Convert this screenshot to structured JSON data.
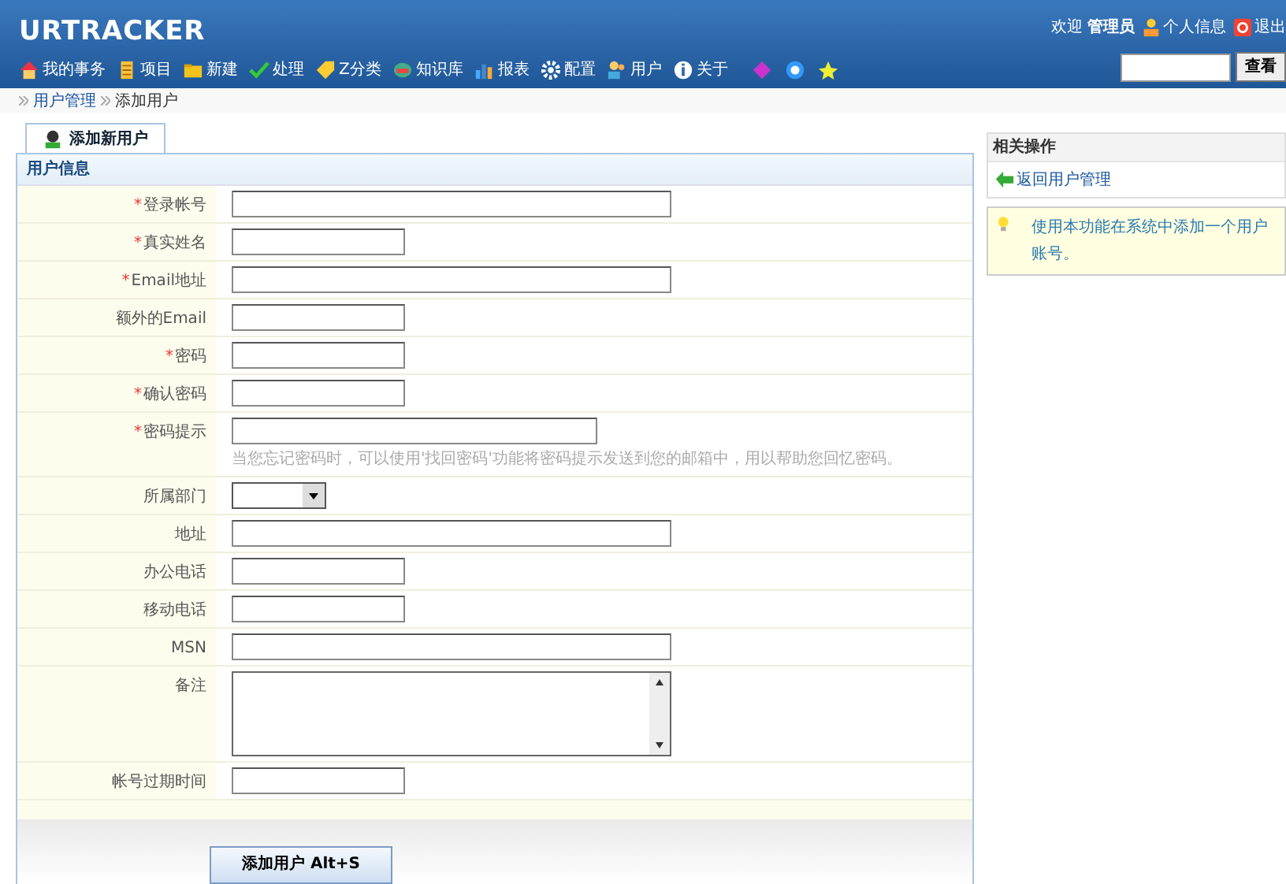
{
  "app_title": "URTRACKER",
  "user_bar": {
    "welcome": "欢迎",
    "user": "管理员",
    "profile": "个人信息",
    "logout": "退出"
  },
  "nav": [
    "我的事务",
    "项目",
    "新建",
    "处理",
    "Z分类",
    "知识库",
    "报表",
    "配置",
    "用户",
    "关于"
  ],
  "search": {
    "button": "查看"
  },
  "breadcrumb": [
    "用户管理",
    "添加用户"
  ],
  "tabs": [
    {
      "label": "添加新用户",
      "selected": true
    }
  ],
  "section_title": "用户信息",
  "fields": [
    {
      "label": "登录帐号",
      "marker": "*",
      "kind": "long"
    },
    {
      "label": "真实姓名",
      "marker": "*",
      "kind": "short"
    },
    {
      "label": "Email地址",
      "marker": "*",
      "kind": "long"
    },
    {
      "label": "额外的Email",
      "kind": "short"
    },
    {
      "label": "密码",
      "marker": "*",
      "kind": "short"
    },
    {
      "label": "确认密码",
      "marker": "*",
      "kind": "short"
    },
    {
      "label": "密码提示",
      "marker": "*",
      "kind": "medium",
      "hint": "当您忘记密码时，可以使用'找回密码'功能将密码提示发送到您的邮箱中，用以帮助您回忆密码。"
    },
    {
      "label": "所属部门",
      "kind": "select"
    },
    {
      "label": "地址",
      "kind": "long"
    },
    {
      "label": "办公电话",
      "kind": "short"
    },
    {
      "label": "移动电话",
      "kind": "short"
    },
    {
      "label": "MSN",
      "kind": "long"
    },
    {
      "label": "备注",
      "kind": "textarea"
    },
    {
      "label": "帐号过期时间",
      "kind": "short"
    }
  ],
  "submit": "添加用户 Alt+S",
  "side": {
    "title": "相关操作",
    "back_link": "返回用户管理",
    "tip": "使用本功能在系统中添加一个用户账号。"
  }
}
